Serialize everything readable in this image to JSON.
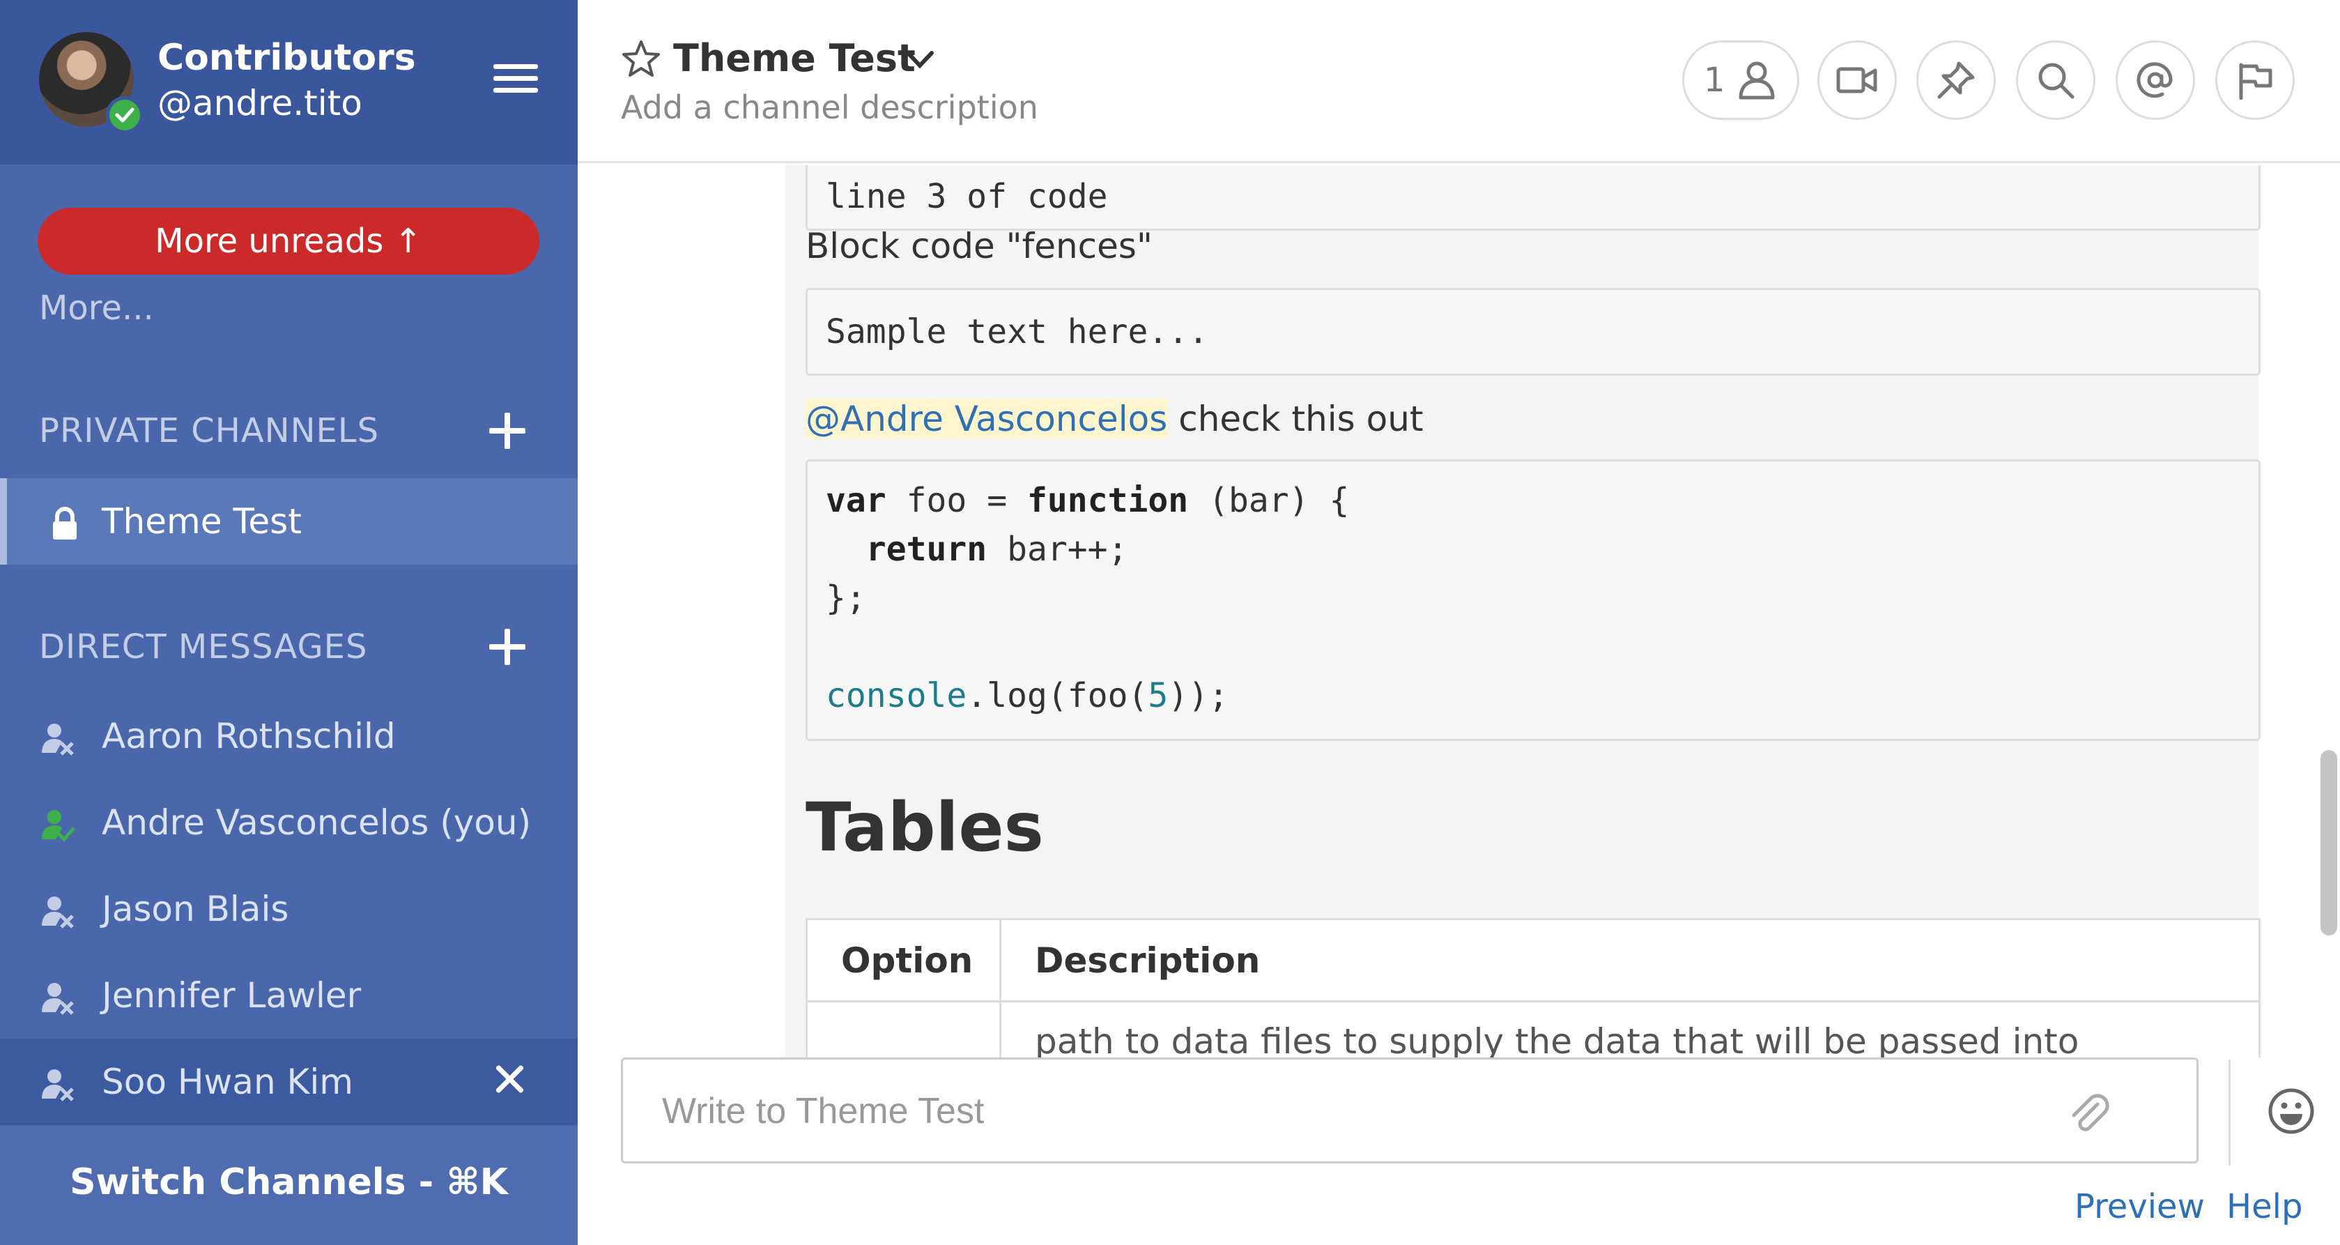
{
  "sidebar": {
    "team_name": "Contributors",
    "username": "@andre.tito",
    "more_unreads": "More unreads ↑",
    "more_link": "More...",
    "private_channels_title": "PRIVATE CHANNELS",
    "private_channels": [
      {
        "label": "Theme Test",
        "icon": "lock-icon",
        "active": true
      }
    ],
    "direct_messages_title": "DIRECT MESSAGES",
    "direct_messages": [
      {
        "label": "Aaron Rothschild",
        "status": "offline"
      },
      {
        "label": "Andre Vasconcelos (you)",
        "status": "online"
      },
      {
        "label": "Jason Blais",
        "status": "offline"
      },
      {
        "label": "Jennifer Lawler",
        "status": "offline"
      },
      {
        "label": "Soo Hwan Kim",
        "status": "offline"
      }
    ],
    "switch_channels": "Switch Channels - ⌘K"
  },
  "header": {
    "channel_title": "Theme Test",
    "channel_description": "Add a channel description",
    "member_count": "1",
    "icons": [
      "member-icon",
      "video-icon",
      "pin-icon",
      "search-icon",
      "mention-icon",
      "flag-icon"
    ]
  },
  "post": {
    "cut_code_text": "line 3 of code",
    "block_fences_label": "Block code \"fences\"",
    "sample_code": "Sample text here...",
    "mention": "@Andre Vasconcelos",
    "mention_rest": " check this out",
    "code_lines": {
      "l1_kw": "var",
      "l1_a": " foo = ",
      "l1_kw2": "function",
      "l1_b": " (bar) {",
      "l2_indent": "  ",
      "l2_kw": "return",
      "l2_b": " bar++;",
      "l3": "};",
      "l5_cn": "console",
      "l5_a": ".log(foo(",
      "l5_num": "5",
      "l5_b": "));"
    },
    "tables_heading": "Tables",
    "table": {
      "headers": [
        "Option",
        "Description"
      ],
      "row1_description": "path to data files to supply the data that will be passed into"
    }
  },
  "footer": {
    "placeholder": "Write to Theme Test",
    "preview": "Preview",
    "help": "Help"
  },
  "colors": {
    "sidebar_bg": "#4a67ab",
    "sidebar_header_bg": "#3a579d",
    "unreads_red": "#cc2a2a",
    "link_blue": "#2f6fb5",
    "online_green": "#3db04a"
  }
}
